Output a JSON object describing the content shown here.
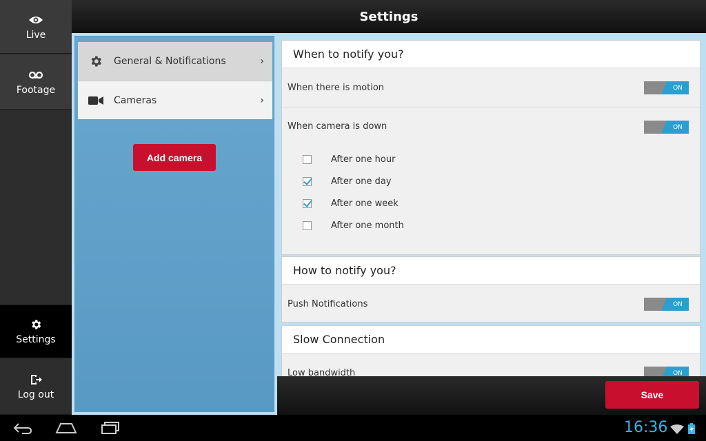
{
  "header": {
    "title": "Settings"
  },
  "rail": {
    "live": "Live",
    "footage": "Footage",
    "settings": "Settings",
    "logout": "Log out"
  },
  "categories": [
    {
      "label": "General & Notifications",
      "icon": "gear-icon",
      "chevron": "›"
    },
    {
      "label": "Cameras",
      "icon": "camera-icon",
      "chevron": "›"
    }
  ],
  "add_camera_label": "Add camera",
  "sections": {
    "when": {
      "title": "When to notify you?",
      "motion_label": "When there is motion",
      "motion_toggle": "ON",
      "down_label": "When camera is down",
      "down_toggle": "ON",
      "options": [
        {
          "label": "After one hour",
          "checked": false
        },
        {
          "label": "After one day",
          "checked": true
        },
        {
          "label": "After one week",
          "checked": true
        },
        {
          "label": "After one month",
          "checked": false
        }
      ]
    },
    "how": {
      "title": "How to notify you?",
      "push_label": "Push Notifications",
      "push_toggle": "ON"
    },
    "slow": {
      "title": "Slow Connection",
      "bandwidth_label": "Low bandwidth",
      "bandwidth_toggle": "ON"
    }
  },
  "save_label": "Save",
  "system": {
    "clock": "16:36"
  },
  "colors": {
    "accent": "#2b9fd0",
    "brand_red": "#c8102e",
    "clock": "#33b5e5"
  }
}
